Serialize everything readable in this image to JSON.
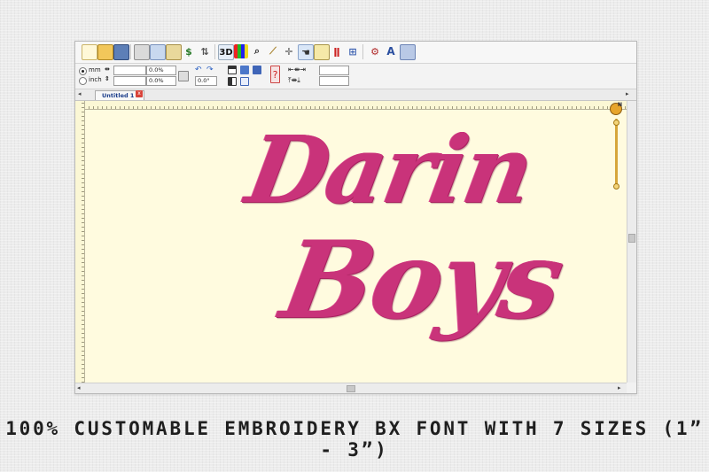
{
  "toolbar": {
    "icons": [
      "new-file-icon",
      "open-folder-icon",
      "save-icon",
      "print-icon",
      "copy-icon",
      "paste-icon",
      "stitch-icon",
      "branch-icon",
      "3d-view-button",
      "color-chart-icon",
      "zoom-icon",
      "measure-icon",
      "select-icon",
      "hand-icon",
      "grid-icon",
      "needle-icon",
      "hoop-icon",
      "settings-icon",
      "text-tool-icon",
      "import-icon"
    ],
    "view3d_label": "3D",
    "text_tool_label": "A"
  },
  "props": {
    "unit_mm": "mm",
    "unit_inch": "inch",
    "width_value": "0.0%",
    "height_value": "0.0%",
    "rotate_value": "0.0°"
  },
  "tabs": {
    "active_label": "Untitled 1 *",
    "close_label": "x"
  },
  "compass_label": "N",
  "embroidery": {
    "line1": "Darin",
    "line2": "Boys",
    "thread_color": "#c9337a"
  },
  "caption": "100% CUSTOMABLE EMBROIDERY BX FONT WITH 7 SIZES (1” -  3”)"
}
